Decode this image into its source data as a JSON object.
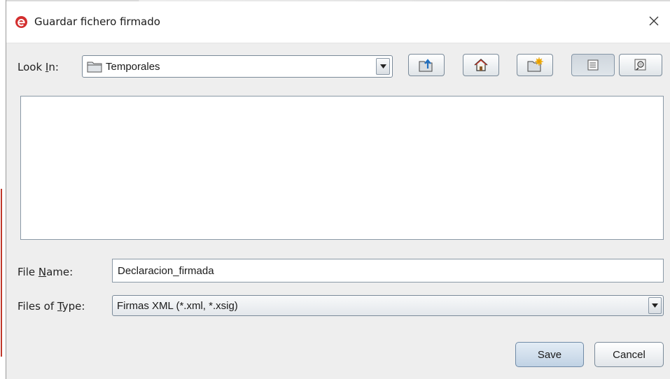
{
  "window": {
    "title": "Guardar fichero firmado",
    "close_glyph": "✕"
  },
  "look_in": {
    "label_prefix": "Look ",
    "label_mnemonic": "I",
    "label_suffix": "n:",
    "value": "Temporales",
    "folder_icon": "folder-icon"
  },
  "toolbar": {
    "buttons": [
      {
        "name": "up-one-level-button",
        "icon": "folder-up-icon"
      },
      {
        "name": "home-button",
        "icon": "home-icon"
      },
      {
        "name": "create-new-folder-button",
        "icon": "new-folder-icon"
      },
      {
        "name": "list-view-button",
        "icon": "list-view-icon",
        "pressed": true
      },
      {
        "name": "details-view-button",
        "icon": "details-view-icon"
      }
    ]
  },
  "file_name": {
    "label_prefix": "File ",
    "label_mnemonic": "N",
    "label_suffix": "ame:",
    "value": "Declaracion_firmada"
  },
  "file_type": {
    "label_prefix": "Files of ",
    "label_mnemonic": "T",
    "label_suffix": "ype:",
    "value": "Firmas XML (*.xml, *.xsig)"
  },
  "buttons": {
    "save": "Save",
    "cancel": "Cancel"
  },
  "colors": {
    "accent": "#d32f2f",
    "primary_button": "#c8d8e8",
    "window_bg": "#eeeeee"
  }
}
